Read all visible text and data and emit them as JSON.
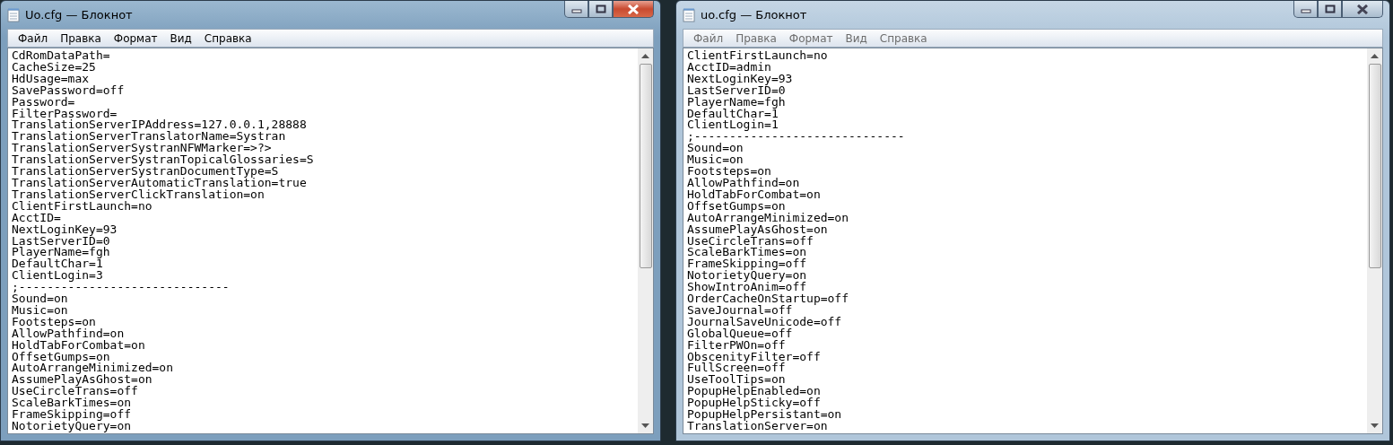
{
  "windows": [
    {
      "title": "Uo.cfg — Блокнот",
      "active": true,
      "menu": [
        "Файл",
        "Правка",
        "Формат",
        "Вид",
        "Справка"
      ],
      "lines": [
        "CdRomDataPath=",
        "CacheSize=25",
        "HdUsage=max",
        "SavePassword=off",
        "Password=",
        "FilterPassword=",
        "TranslationServerIPAddress=127.0.0.1,28888",
        "TranslationServerTranslatorName=Systran",
        "TranslationServerSystranNFWMarker=>?>",
        "TranslationServerSystranTopicalGlossaries=S",
        "TranslationServerSystranDocumentType=S",
        "TranslationServerAutomaticTranslation=true",
        "TranslationServerClickTranslation=on",
        "ClientFirstLaunch=no",
        "AcctID=",
        "NextLoginKey=93",
        "LastServerID=0",
        "PlayerName=fgh",
        "DefaultChar=1",
        "ClientLogin=3",
        ";------------------------------",
        "Sound=on",
        "Music=on",
        "Footsteps=on",
        "AllowPathfind=on",
        "HoldTabForCombat=on",
        "OffsetGumps=on",
        "AutoArrangeMinimized=on",
        "AssumePlayAsGhost=on",
        "UseCircleTrans=off",
        "ScaleBarkTimes=on",
        "FrameSkipping=off",
        "NotorietyQuery=on"
      ]
    },
    {
      "title": "uo.cfg — Блокнот",
      "active": false,
      "menu": [
        "Файл",
        "Правка",
        "Формат",
        "Вид",
        "Справка"
      ],
      "lines": [
        "ClientFirstLaunch=no",
        "AcctID=admin",
        "NextLoginKey=93",
        "LastServerID=0",
        "PlayerName=fgh",
        "DefaultChar=1",
        "ClientLogin=1",
        ";------------------------------",
        "Sound=on",
        "Music=on",
        "Footsteps=on",
        "AllowPathfind=on",
        "HoldTabForCombat=on",
        "OffsetGumps=on",
        "AutoArrangeMinimized=on",
        "AssumePlayAsGhost=on",
        "UseCircleTrans=off",
        "ScaleBarkTimes=on",
        "FrameSkipping=off",
        "NotorietyQuery=on",
        "ShowIntroAnim=off",
        "OrderCacheOnStartup=off",
        "SaveJournal=off",
        "JournalSaveUnicode=off",
        "GlobalQueue=off",
        "FilterPWOn=off",
        "ObscenityFilter=off",
        "FullScreen=off",
        "UseToolTips=on",
        "PopupHelpEnabled=on",
        "PopupHelpSticky=off",
        "PopupHelpPersistant=on",
        "TranslationServer=on"
      ]
    }
  ]
}
